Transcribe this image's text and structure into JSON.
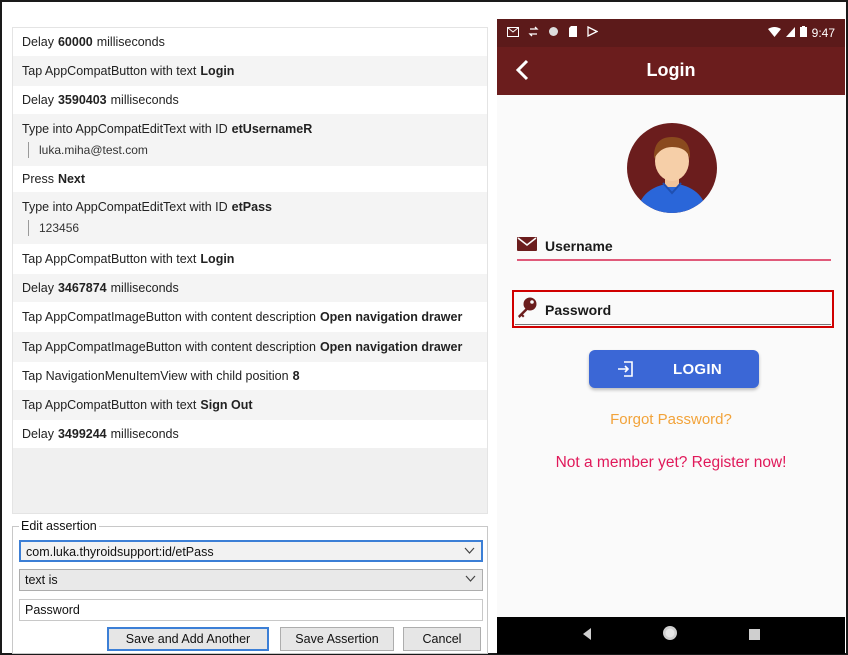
{
  "recorder": {
    "steps": [
      {
        "text": "Delay",
        "bold": "60000",
        "after": "milliseconds"
      },
      {
        "text": "Tap AppCompatButton with text",
        "bold": "Login",
        "after": ""
      },
      {
        "text": "Delay",
        "bold": "3590403",
        "after": "milliseconds"
      },
      {
        "text": "Type into AppCompatEditText with ID",
        "bold": "etUsernameR",
        "after": "",
        "sub": "luka.miha@test.com"
      },
      {
        "text": "Press",
        "bold": "Next",
        "after": ""
      },
      {
        "text": "Type into AppCompatEditText with ID",
        "bold": "etPass",
        "after": "",
        "sub": "123456"
      },
      {
        "text": "Tap AppCompatButton with text",
        "bold": "Login",
        "after": ""
      },
      {
        "text": "Delay",
        "bold": "3467874",
        "after": "milliseconds"
      },
      {
        "text": "Tap AppCompatImageButton with content description",
        "bold": "Open navigation drawer",
        "after": ""
      },
      {
        "text": "Tap AppCompatImageButton with content description",
        "bold": "Open navigation drawer",
        "after": ""
      },
      {
        "text": "Tap NavigationMenuItemView with child position",
        "bold": "8",
        "after": ""
      },
      {
        "text": "Tap AppCompatButton with text",
        "bold": "Sign Out",
        "after": ""
      },
      {
        "text": "Delay",
        "bold": "3499244",
        "after": "milliseconds"
      }
    ]
  },
  "assertion": {
    "legend": "Edit assertion",
    "view_id": "com.luka.thyroidsupport:id/etPass",
    "condition": "text is",
    "value": "Password",
    "save_add_label": "Save and Add Another",
    "save_label": "Save Assertion",
    "cancel_label": "Cancel"
  },
  "phone": {
    "status_time": "9:47",
    "title": "Login",
    "username_label": "Username",
    "password_label": "Password",
    "login_label": "LOGIN",
    "forgot_label": "Forgot Password?",
    "register_label": "Not a member yet? Register now!",
    "colors": {
      "appbar": "#6b1d1d",
      "status": "#5c1a1a",
      "login_button": "#3b67d6",
      "forgot": "#f2a33a",
      "register": "#e0195a",
      "highlight": "#d00000"
    }
  }
}
